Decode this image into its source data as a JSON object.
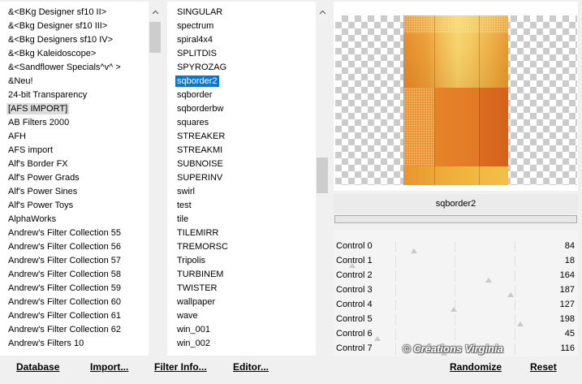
{
  "categories": {
    "items": [
      "&<BKg Designer sf10 II>",
      "&<Bkg Designer sf10 III>",
      "&<Bkg Designers sf10 IV>",
      "&<Bkg Kaleidoscope>",
      "&<Sandflower Specials^v^ >",
      "&Neu!",
      "24-bit Transparency",
      "[AFS IMPORT]",
      "AB Filters 2000",
      "AFH",
      "AFS import",
      "Alf's Border FX",
      "Alf's Power Grads",
      "Alf's Power Sines",
      "Alf's Power Toys",
      "AlphaWorks",
      "Andrew's Filter Collection 55",
      "Andrew's Filter Collection 56",
      "Andrew's Filter Collection 57",
      "Andrew's Filter Collection 58",
      "Andrew's Filter Collection 59",
      "Andrew's Filter Collection 60",
      "Andrew's Filter Collection 61",
      "Andrew's Filter Collection 62",
      "Andrew's Filters 10"
    ],
    "selected_index": 7
  },
  "filters": {
    "items": [
      "SINGULAR",
      "spectrum",
      "spiral4x4",
      "SPLITDIS",
      "SPYROZAG",
      "sqborder2",
      "sqborder",
      "sqborderbw",
      "squares",
      "STREAKER",
      "STREAKMI",
      "SUBNOISE",
      "SUPERINV",
      "swirl",
      "test",
      "tile",
      "TILEMIRR",
      "TREMORSC",
      "Tripolis",
      "TURBINEM",
      "TWISTER",
      "wallpaper",
      "wave",
      "win_001",
      "win_002"
    ],
    "selected_index": 5
  },
  "preview": {
    "filter_name": "sqborder2"
  },
  "controls": [
    {
      "label": "Control 0",
      "value": 84
    },
    {
      "label": "Control 1",
      "value": 18
    },
    {
      "label": "Control 2",
      "value": 164
    },
    {
      "label": "Control 3",
      "value": 187
    },
    {
      "label": "Control 4",
      "value": 127
    },
    {
      "label": "Control 5",
      "value": 198
    },
    {
      "label": "Control 6",
      "value": 45
    },
    {
      "label": "Control 7",
      "value": 116
    }
  ],
  "buttons": {
    "database": "Database",
    "import": "Import...",
    "filter_info": "Filter Info...",
    "editor": "Editor...",
    "randomize": "Randomize",
    "reset": "Reset"
  },
  "watermark": "© Créations Virginia",
  "icons": {
    "scroll_up": "chevron-up-icon"
  },
  "colors": {
    "selection_bg": "#0078d7",
    "selection_text": "#ffffff",
    "inactive_selection_bg": "#dcdcdc"
  }
}
